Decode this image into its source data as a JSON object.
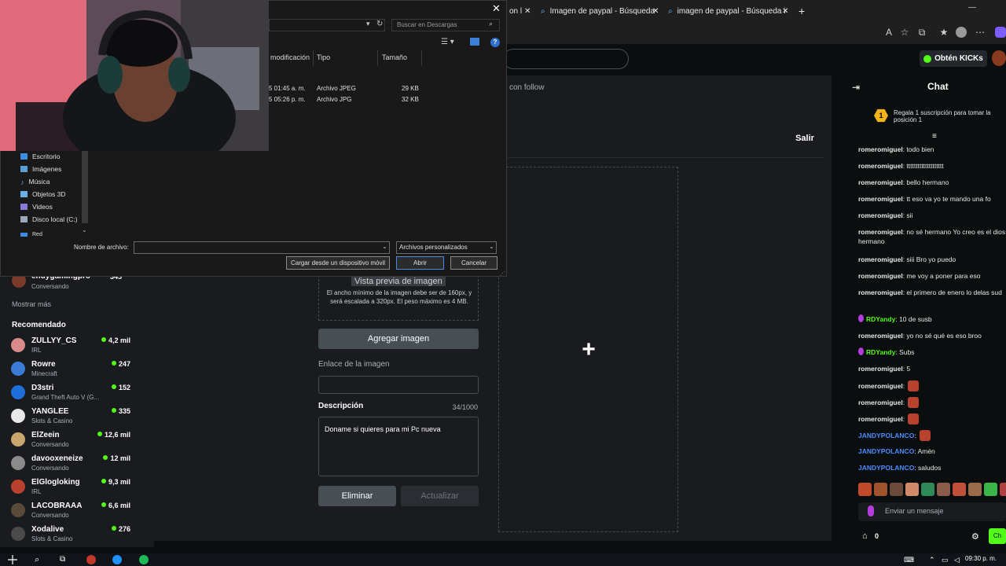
{
  "browser": {
    "tabs": [
      {
        "title": "on l",
        "close": "✕"
      },
      {
        "title": "Imagen de paypal - Búsqueda",
        "close": "✕"
      },
      {
        "title": "imagen de paypal - Búsqueda ima",
        "close": "✕"
      }
    ],
    "new_tab": "+"
  },
  "kick": {
    "kicks_button": "Obtén KICKs",
    "follow_text": "con follow",
    "salir": "Salir"
  },
  "panel_form": {
    "preview_title": "Vista previa de imagen",
    "preview_help": "El ancho mínimo de la imagen debe ser de 160px, y será escalada a 320px. El peso máximo es 4 MB.",
    "add_image": "Agregar imagen",
    "link_label": "Enlace de la imagen",
    "description_label": "Descripción",
    "description_count": "34/1000",
    "description_value": "Doname si quieres para mi Pc nueva",
    "delete": "Eliminar",
    "update": "Actualizar"
  },
  "sidebar": {
    "partial_channel": {
      "name": "endygamingpro",
      "category": "Conversando",
      "viewers": "345"
    },
    "show_more": "Mostrar más",
    "recommended_heading": "Recomendado",
    "recommended": [
      {
        "name": "ZULLYY_CS",
        "category": "IRL",
        "viewers": "4,2 mil"
      },
      {
        "name": "Rowre",
        "category": "Minecraft",
        "viewers": "247"
      },
      {
        "name": "D3stri",
        "category": "Grand Theft Auto V (G...",
        "viewers": "152"
      },
      {
        "name": "YANGLEE",
        "category": "Slots & Casino",
        "viewers": "335"
      },
      {
        "name": "ElZeein",
        "category": "Conversando",
        "viewers": "12,6 mil"
      },
      {
        "name": "davooxeneize",
        "category": "Conversando",
        "viewers": "12 mil"
      },
      {
        "name": "ElGlogloking",
        "category": "IRL",
        "viewers": "9,3 mil"
      },
      {
        "name": "LACOBRAAA",
        "category": "Conversando",
        "viewers": "6,6 mil"
      },
      {
        "name": "Xodalive",
        "category": "Slots & Casino",
        "viewers": "276"
      }
    ]
  },
  "chat": {
    "title": "Chat",
    "gift_rank": "1",
    "gift_text": "Regala 1 suscripción para tomar la posición 1",
    "messages": [
      {
        "user": "romeromiguel",
        "text": "todo bien",
        "color": "#e8e8e8"
      },
      {
        "user": "romeromiguel",
        "text": "tttttttttttttttttttt",
        "color": "#e8e8e8"
      },
      {
        "user": "romeromiguel",
        "text": "bello hermano",
        "color": "#e8e8e8"
      },
      {
        "user": "romeromiguel",
        "text": "tt eso va yo te mando una fo",
        "color": "#e8e8e8"
      },
      {
        "user": "romeromiguel",
        "text": "sii",
        "color": "#e8e8e8"
      },
      {
        "user": "romeromiguel",
        "text": "no sé hermano Yo creo es el dios hermano",
        "color": "#e8e8e8"
      },
      {
        "user": "romeromiguel",
        "text": "siii Bro yo puedo",
        "color": "#e8e8e8"
      },
      {
        "user": "romeromiguel",
        "text": "me voy a poner para eso",
        "color": "#e8e8e8"
      },
      {
        "user": "romeromiguel",
        "text": "el primero de enero lo delas sud",
        "color": "#e8e8e8"
      },
      {
        "user": "RDYandy",
        "text": "10 de susb",
        "color": "#53fc18",
        "badge": true
      },
      {
        "user": "romeromiguel",
        "text": "yo no sé qué es eso broo",
        "color": "#e8e8e8"
      },
      {
        "user": "RDYandy",
        "text": "Subs",
        "color": "#53fc18",
        "badge": true
      },
      {
        "user": "romeromiguel",
        "text": "5",
        "color": "#e8e8e8"
      },
      {
        "user": "romeromiguel",
        "text": "",
        "color": "#e8e8e8",
        "emote": true
      },
      {
        "user": "romeromiguel",
        "text": "",
        "color": "#e8e8e8",
        "emote": true
      },
      {
        "user": "romeromiguel",
        "text": "",
        "color": "#e8e8e8",
        "emote": true
      },
      {
        "user": "JANDYPOLANCO",
        "text": "",
        "color": "#4c8dff",
        "emote": true
      },
      {
        "user": "JANDYPOLANCO",
        "text": "Amén",
        "color": "#4c8dff"
      },
      {
        "user": "JANDYPOLANCO",
        "text": "saludos",
        "color": "#4c8dff"
      }
    ],
    "input_placeholder": "Enviar un mensaje",
    "points": "0",
    "send": "Ch"
  },
  "file_dialog": {
    "search_placeholder": "Buscar en Descargas",
    "columns": [
      "modificación",
      "Tipo",
      "Tamaño"
    ],
    "files": [
      {
        "modified": "5 01:45 a. m.",
        "type": "Archivo JPEG",
        "size": "29 KB"
      },
      {
        "modified": "5 05:26 p. m.",
        "type": "Archivo JPG",
        "size": "32 KB"
      }
    ],
    "nav_items": [
      "Escritorio",
      "Imágenes",
      "Música",
      "Objetos 3D",
      "Videos",
      "Disco local (C:)"
    ],
    "nav_partial": "Red",
    "filename_label": "Nombre de archivo:",
    "filename_value": "",
    "filetype": "Archivos personalizados",
    "mobile_button": "Cargar desde un dispositivo móvil",
    "open_button": "Abrir",
    "cancel_button": "Cancelar"
  },
  "taskbar": {
    "clock": "09:30 p. m."
  },
  "colors": {
    "kick_green": "#53fc18",
    "chat_blue": "#4c8dff",
    "badge_purple": "#b53de0"
  }
}
